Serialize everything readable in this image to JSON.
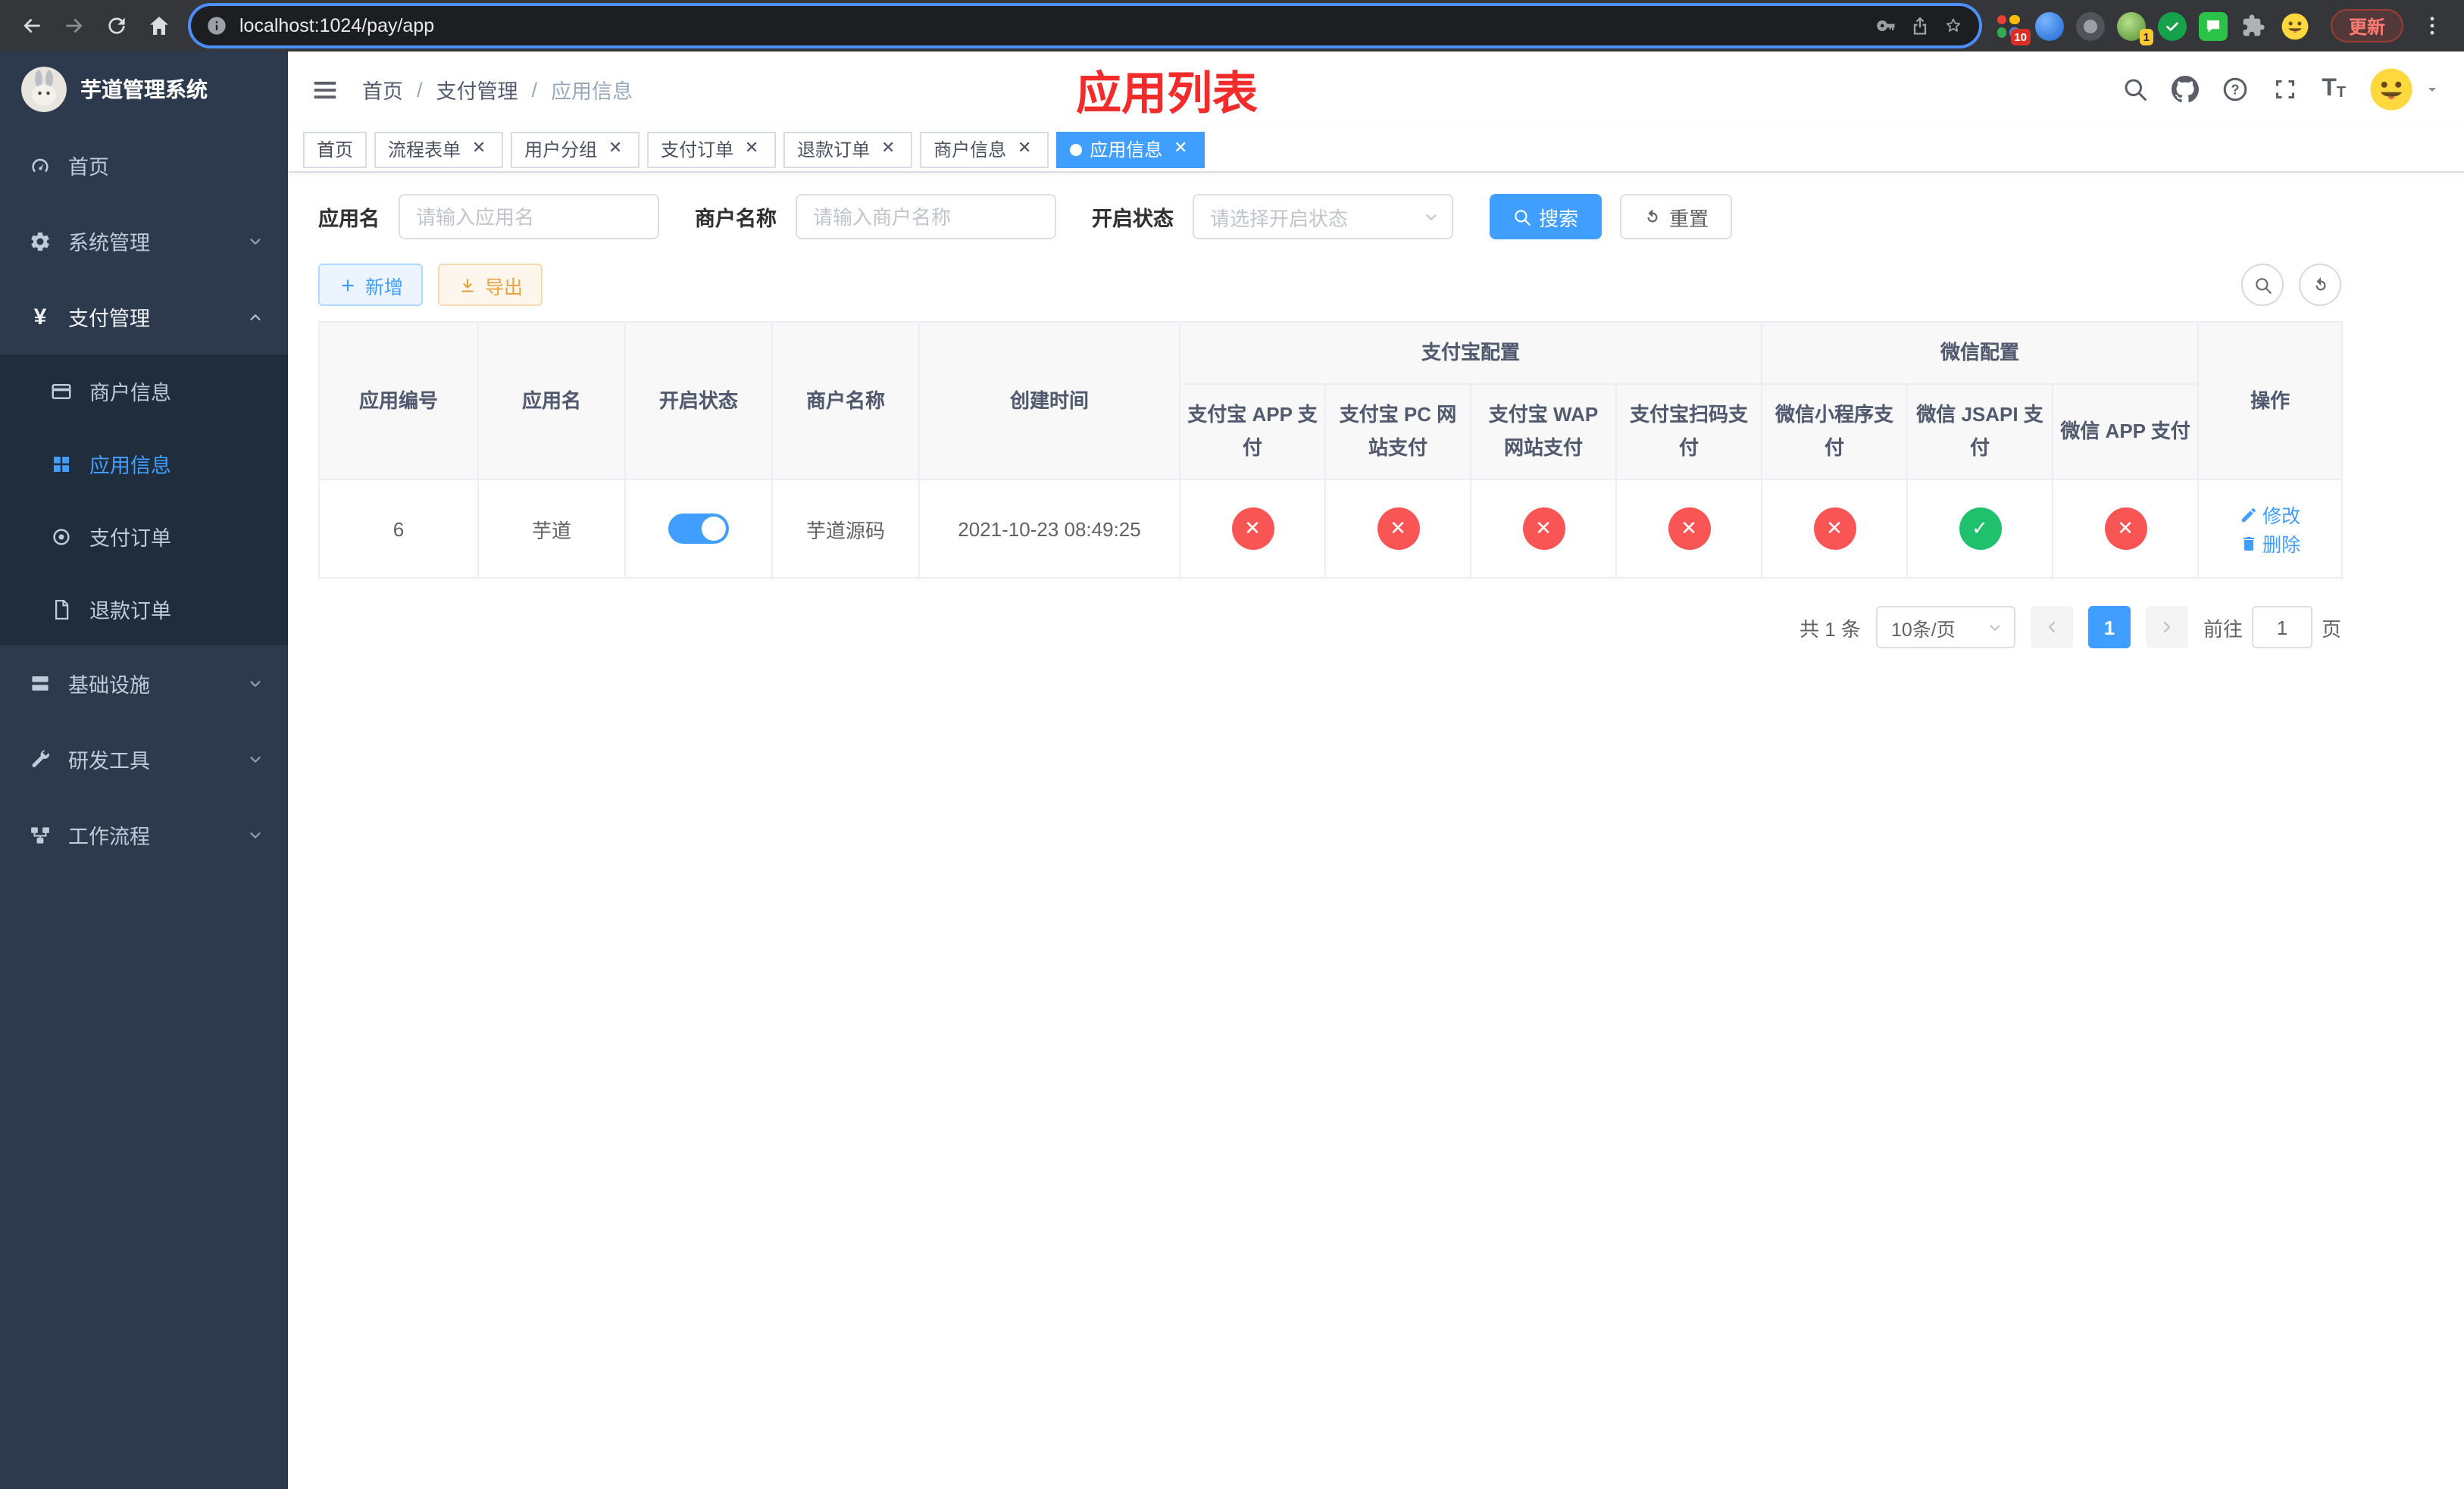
{
  "colors": {
    "accent": "#409eff",
    "title-red": "#f22b2b",
    "status-no": "#f95555",
    "status-yes": "#1fc16d",
    "warning": "#e6a23c"
  },
  "browser": {
    "url": "localhost:1024/pay/app",
    "update_label": "更新",
    "tab_ext_badge": "10",
    "avatar_ext_badge": "1"
  },
  "sidebar": {
    "title": "芋道管理系统",
    "menu": [
      {
        "label": "首页"
      },
      {
        "label": "系统管理"
      },
      {
        "label": "支付管理"
      },
      {
        "label": "商户信息"
      },
      {
        "label": "应用信息"
      },
      {
        "label": "支付订单"
      },
      {
        "label": "退款订单"
      },
      {
        "label": "基础设施"
      },
      {
        "label": "研发工具"
      },
      {
        "label": "工作流程"
      }
    ]
  },
  "header": {
    "breadcrumb": [
      "首页",
      "支付管理",
      "应用信息"
    ],
    "title": "应用列表"
  },
  "tabs": [
    {
      "label": "首页",
      "closable": false,
      "active": false
    },
    {
      "label": "流程表单",
      "closable": true,
      "active": false
    },
    {
      "label": "用户分组",
      "closable": true,
      "active": false
    },
    {
      "label": "支付订单",
      "closable": true,
      "active": false
    },
    {
      "label": "退款订单",
      "closable": true,
      "active": false
    },
    {
      "label": "商户信息",
      "closable": true,
      "active": false
    },
    {
      "label": "应用信息",
      "closable": true,
      "active": true
    }
  ],
  "filters": {
    "app_name_label": "应用名",
    "app_name_placeholder": "请输入应用名",
    "merchant_label": "商户名称",
    "merchant_placeholder": "请输入商户名称",
    "status_label": "开启状态",
    "status_placeholder": "请选择开启状态",
    "search_label": "搜索",
    "reset_label": "重置"
  },
  "toolbar": {
    "add_label": "新增",
    "export_label": "导出"
  },
  "table": {
    "columns": {
      "id_label": "应用编号",
      "name_label": "应用名",
      "status_label": "开启状态",
      "merchant_label": "商户名称",
      "created_label": "创建时间",
      "alipay_group": "支付宝配置",
      "wechat_group": "微信配置",
      "ops_label": "操作",
      "alipay": [
        "支付宝 APP 支付",
        "支付宝 PC 网站支付",
        "支付宝 WAP 网站支付",
        "支付宝扫码支付"
      ],
      "wechat": [
        "微信小程序支付",
        "微信 JSAPI 支付",
        "微信 APP 支付"
      ]
    },
    "rows": [
      {
        "id": "6",
        "name": "芋道",
        "enabled": "on",
        "merchant": "芋道源码",
        "created": "2021-10-23 08:49:25",
        "channels": [
          "no",
          "no",
          "no",
          "no",
          "no",
          "yes",
          "no"
        ],
        "edit_label": "修改",
        "delete_label": "删除"
      }
    ]
  },
  "pagination": {
    "total": "共 1 条",
    "page_size": "10条/页",
    "page": "1",
    "goto": "前往",
    "goto_value": "1",
    "unit": "页"
  }
}
